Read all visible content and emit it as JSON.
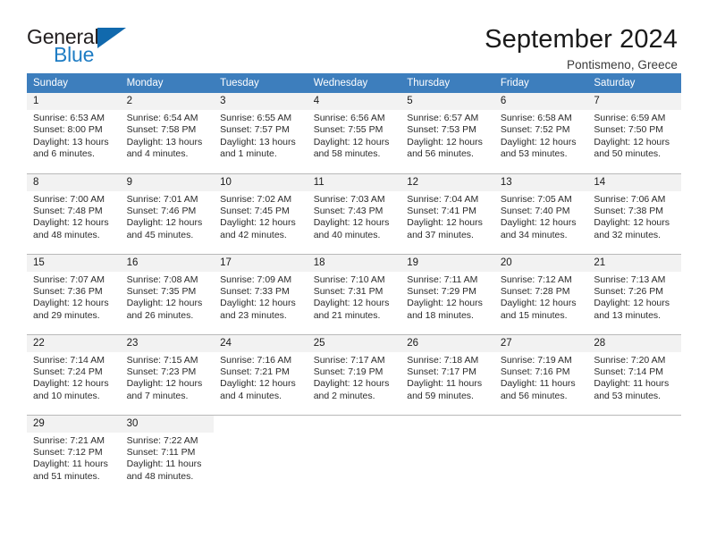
{
  "brand": {
    "name_part1": "General",
    "name_part2": "Blue",
    "accent_color": "#1169ad",
    "text_color": "#231f20"
  },
  "header": {
    "title": "September 2024",
    "subtitle": "Pontismeno, Greece",
    "header_bg_color": "#3d7ebd"
  },
  "weekday_headers": [
    "Sunday",
    "Monday",
    "Tuesday",
    "Wednesday",
    "Thursday",
    "Friday",
    "Saturday"
  ],
  "labels": {
    "sunrise": "Sunrise:",
    "sunset": "Sunset:",
    "daylight": "Daylight:"
  },
  "weeks": [
    [
      {
        "day": "1",
        "sunrise": "Sunrise: 6:53 AM",
        "sunset": "Sunset: 8:00 PM",
        "daylight_line1": "Daylight: 13 hours",
        "daylight_line2": "and 6 minutes."
      },
      {
        "day": "2",
        "sunrise": "Sunrise: 6:54 AM",
        "sunset": "Sunset: 7:58 PM",
        "daylight_line1": "Daylight: 13 hours",
        "daylight_line2": "and 4 minutes."
      },
      {
        "day": "3",
        "sunrise": "Sunrise: 6:55 AM",
        "sunset": "Sunset: 7:57 PM",
        "daylight_line1": "Daylight: 13 hours",
        "daylight_line2": "and 1 minute."
      },
      {
        "day": "4",
        "sunrise": "Sunrise: 6:56 AM",
        "sunset": "Sunset: 7:55 PM",
        "daylight_line1": "Daylight: 12 hours",
        "daylight_line2": "and 58 minutes."
      },
      {
        "day": "5",
        "sunrise": "Sunrise: 6:57 AM",
        "sunset": "Sunset: 7:53 PM",
        "daylight_line1": "Daylight: 12 hours",
        "daylight_line2": "and 56 minutes."
      },
      {
        "day": "6",
        "sunrise": "Sunrise: 6:58 AM",
        "sunset": "Sunset: 7:52 PM",
        "daylight_line1": "Daylight: 12 hours",
        "daylight_line2": "and 53 minutes."
      },
      {
        "day": "7",
        "sunrise": "Sunrise: 6:59 AM",
        "sunset": "Sunset: 7:50 PM",
        "daylight_line1": "Daylight: 12 hours",
        "daylight_line2": "and 50 minutes."
      }
    ],
    [
      {
        "day": "8",
        "sunrise": "Sunrise: 7:00 AM",
        "sunset": "Sunset: 7:48 PM",
        "daylight_line1": "Daylight: 12 hours",
        "daylight_line2": "and 48 minutes."
      },
      {
        "day": "9",
        "sunrise": "Sunrise: 7:01 AM",
        "sunset": "Sunset: 7:46 PM",
        "daylight_line1": "Daylight: 12 hours",
        "daylight_line2": "and 45 minutes."
      },
      {
        "day": "10",
        "sunrise": "Sunrise: 7:02 AM",
        "sunset": "Sunset: 7:45 PM",
        "daylight_line1": "Daylight: 12 hours",
        "daylight_line2": "and 42 minutes."
      },
      {
        "day": "11",
        "sunrise": "Sunrise: 7:03 AM",
        "sunset": "Sunset: 7:43 PM",
        "daylight_line1": "Daylight: 12 hours",
        "daylight_line2": "and 40 minutes."
      },
      {
        "day": "12",
        "sunrise": "Sunrise: 7:04 AM",
        "sunset": "Sunset: 7:41 PM",
        "daylight_line1": "Daylight: 12 hours",
        "daylight_line2": "and 37 minutes."
      },
      {
        "day": "13",
        "sunrise": "Sunrise: 7:05 AM",
        "sunset": "Sunset: 7:40 PM",
        "daylight_line1": "Daylight: 12 hours",
        "daylight_line2": "and 34 minutes."
      },
      {
        "day": "14",
        "sunrise": "Sunrise: 7:06 AM",
        "sunset": "Sunset: 7:38 PM",
        "daylight_line1": "Daylight: 12 hours",
        "daylight_line2": "and 32 minutes."
      }
    ],
    [
      {
        "day": "15",
        "sunrise": "Sunrise: 7:07 AM",
        "sunset": "Sunset: 7:36 PM",
        "daylight_line1": "Daylight: 12 hours",
        "daylight_line2": "and 29 minutes."
      },
      {
        "day": "16",
        "sunrise": "Sunrise: 7:08 AM",
        "sunset": "Sunset: 7:35 PM",
        "daylight_line1": "Daylight: 12 hours",
        "daylight_line2": "and 26 minutes."
      },
      {
        "day": "17",
        "sunrise": "Sunrise: 7:09 AM",
        "sunset": "Sunset: 7:33 PM",
        "daylight_line1": "Daylight: 12 hours",
        "daylight_line2": "and 23 minutes."
      },
      {
        "day": "18",
        "sunrise": "Sunrise: 7:10 AM",
        "sunset": "Sunset: 7:31 PM",
        "daylight_line1": "Daylight: 12 hours",
        "daylight_line2": "and 21 minutes."
      },
      {
        "day": "19",
        "sunrise": "Sunrise: 7:11 AM",
        "sunset": "Sunset: 7:29 PM",
        "daylight_line1": "Daylight: 12 hours",
        "daylight_line2": "and 18 minutes."
      },
      {
        "day": "20",
        "sunrise": "Sunrise: 7:12 AM",
        "sunset": "Sunset: 7:28 PM",
        "daylight_line1": "Daylight: 12 hours",
        "daylight_line2": "and 15 minutes."
      },
      {
        "day": "21",
        "sunrise": "Sunrise: 7:13 AM",
        "sunset": "Sunset: 7:26 PM",
        "daylight_line1": "Daylight: 12 hours",
        "daylight_line2": "and 13 minutes."
      }
    ],
    [
      {
        "day": "22",
        "sunrise": "Sunrise: 7:14 AM",
        "sunset": "Sunset: 7:24 PM",
        "daylight_line1": "Daylight: 12 hours",
        "daylight_line2": "and 10 minutes."
      },
      {
        "day": "23",
        "sunrise": "Sunrise: 7:15 AM",
        "sunset": "Sunset: 7:23 PM",
        "daylight_line1": "Daylight: 12 hours",
        "daylight_line2": "and 7 minutes."
      },
      {
        "day": "24",
        "sunrise": "Sunrise: 7:16 AM",
        "sunset": "Sunset: 7:21 PM",
        "daylight_line1": "Daylight: 12 hours",
        "daylight_line2": "and 4 minutes."
      },
      {
        "day": "25",
        "sunrise": "Sunrise: 7:17 AM",
        "sunset": "Sunset: 7:19 PM",
        "daylight_line1": "Daylight: 12 hours",
        "daylight_line2": "and 2 minutes."
      },
      {
        "day": "26",
        "sunrise": "Sunrise: 7:18 AM",
        "sunset": "Sunset: 7:17 PM",
        "daylight_line1": "Daylight: 11 hours",
        "daylight_line2": "and 59 minutes."
      },
      {
        "day": "27",
        "sunrise": "Sunrise: 7:19 AM",
        "sunset": "Sunset: 7:16 PM",
        "daylight_line1": "Daylight: 11 hours",
        "daylight_line2": "and 56 minutes."
      },
      {
        "day": "28",
        "sunrise": "Sunrise: 7:20 AM",
        "sunset": "Sunset: 7:14 PM",
        "daylight_line1": "Daylight: 11 hours",
        "daylight_line2": "and 53 minutes."
      }
    ],
    [
      {
        "day": "29",
        "sunrise": "Sunrise: 7:21 AM",
        "sunset": "Sunset: 7:12 PM",
        "daylight_line1": "Daylight: 11 hours",
        "daylight_line2": "and 51 minutes."
      },
      {
        "day": "30",
        "sunrise": "Sunrise: 7:22 AM",
        "sunset": "Sunset: 7:11 PM",
        "daylight_line1": "Daylight: 11 hours",
        "daylight_line2": "and 48 minutes."
      },
      {
        "day": "",
        "sunrise": "",
        "sunset": "",
        "daylight_line1": "",
        "daylight_line2": ""
      },
      {
        "day": "",
        "sunrise": "",
        "sunset": "",
        "daylight_line1": "",
        "daylight_line2": ""
      },
      {
        "day": "",
        "sunrise": "",
        "sunset": "",
        "daylight_line1": "",
        "daylight_line2": ""
      },
      {
        "day": "",
        "sunrise": "",
        "sunset": "",
        "daylight_line1": "",
        "daylight_line2": ""
      },
      {
        "day": "",
        "sunrise": "",
        "sunset": "",
        "daylight_line1": "",
        "daylight_line2": ""
      }
    ]
  ]
}
